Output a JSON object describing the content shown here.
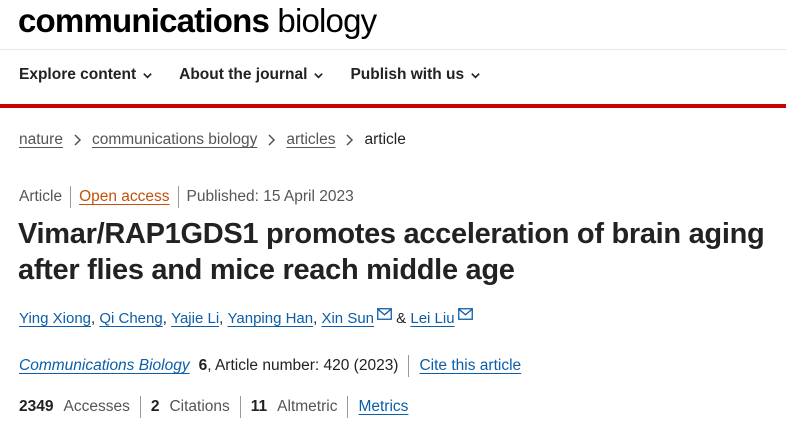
{
  "brand": {
    "bold": "communications",
    "light": "biology"
  },
  "nav": [
    {
      "label": "Explore content"
    },
    {
      "label": "About the journal"
    },
    {
      "label": "Publish with us"
    }
  ],
  "breadcrumb": [
    "nature",
    "communications biology",
    "articles",
    "article"
  ],
  "meta": {
    "type": "Article",
    "access": "Open access",
    "published": "Published: 15 April 2023"
  },
  "title": "Vimar/RAP1GDS1 promotes acceleration of brain aging after flies and mice reach middle age",
  "authors": [
    {
      "name": "Ying Xiong",
      "after": ", "
    },
    {
      "name": "Qi Cheng",
      "after": ", "
    },
    {
      "name": "Yajie Li",
      "after": ", "
    },
    {
      "name": "Yanping Han",
      "after": ", "
    },
    {
      "name": "Xin Sun",
      "after": " & ",
      "email_icon": "mail-icon"
    },
    {
      "name": "Lei Liu",
      "after": "",
      "email_icon": "mail-icon"
    }
  ],
  "citation": {
    "journal": "Communications Biology",
    "volume": "6",
    "rest": ", Article number: 420 (2023)",
    "cite": "Cite this article"
  },
  "metrics": {
    "accesses_num": "2349",
    "accesses_label": "Accesses",
    "citations_num": "2",
    "citations_label": "Citations",
    "altmetric_num": "11",
    "altmetric_label": "Altmetric",
    "link": "Metrics"
  },
  "colors": {
    "accent_red": "#cc0000",
    "link_blue": "#0c5ea8",
    "open_access_orange": "#c2510b"
  }
}
